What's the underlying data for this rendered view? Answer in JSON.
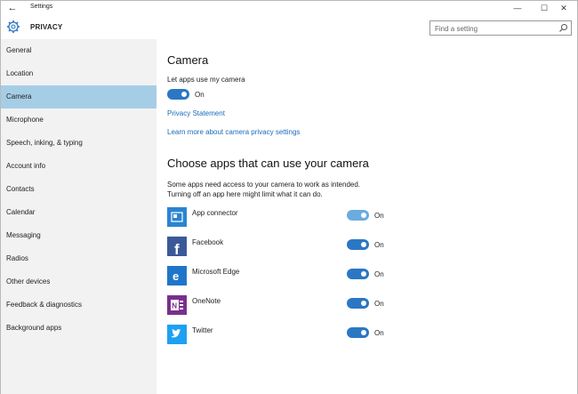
{
  "window": {
    "title": "Settings"
  },
  "header": {
    "section": "PRIVACY",
    "search_placeholder": "Find a setting"
  },
  "sidebar": {
    "items": [
      {
        "label": "General"
      },
      {
        "label": "Location"
      },
      {
        "label": "Camera"
      },
      {
        "label": "Microphone"
      },
      {
        "label": "Speech, inking, & typing"
      },
      {
        "label": "Account info"
      },
      {
        "label": "Contacts"
      },
      {
        "label": "Calendar"
      },
      {
        "label": "Messaging"
      },
      {
        "label": "Radios"
      },
      {
        "label": "Other devices"
      },
      {
        "label": "Feedback & diagnostics"
      },
      {
        "label": "Background apps"
      }
    ],
    "active_item": "Camera"
  },
  "main": {
    "title": "Camera",
    "master_label": "Let apps use my camera",
    "master_state": "On",
    "privacy_link": "Privacy Statement",
    "learn_link": "Learn more about camera privacy settings",
    "apps_heading": "Choose apps that can use your camera",
    "apps_desc_line1": "Some apps need access to your camera to work as intended.",
    "apps_desc_line2": "Turning off an app here might limit what it can do.",
    "apps": [
      {
        "name": "App connector",
        "state": "On",
        "icon": "app-connector-icon",
        "color": "#2b84d1"
      },
      {
        "name": "Facebook",
        "state": "On",
        "icon": "facebook-icon",
        "color": "#3b5998"
      },
      {
        "name": "Microsoft Edge",
        "state": "On",
        "icon": "edge-icon",
        "color": "#1f76c9"
      },
      {
        "name": "OneNote",
        "state": "On",
        "icon": "onenote-icon",
        "color": "#7a2f8e"
      },
      {
        "name": "Twitter",
        "state": "On",
        "icon": "twitter-icon",
        "color": "#1da1f2"
      }
    ]
  },
  "colors": {
    "accent": "#2b77c3",
    "active_nav": "#a6cde6",
    "link": "#1a6bb8"
  }
}
